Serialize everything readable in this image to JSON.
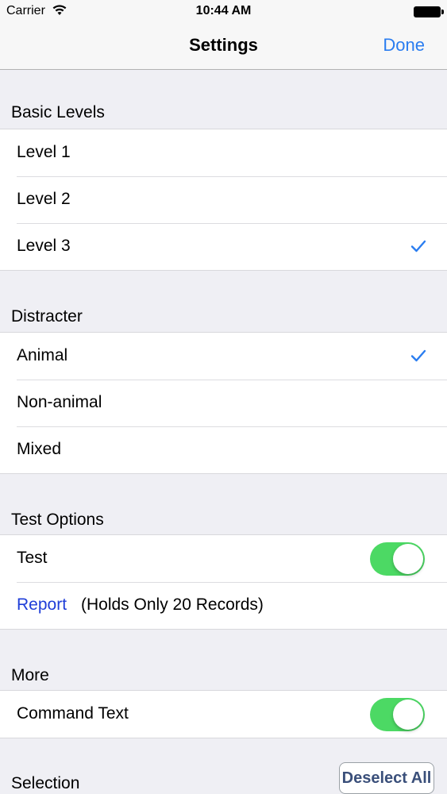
{
  "status_bar": {
    "carrier": "Carrier",
    "time": "10:44 AM"
  },
  "nav": {
    "title": "Settings",
    "done_label": "Done"
  },
  "sections": {
    "basic_levels": {
      "header": "Basic Levels",
      "items": [
        {
          "label": "Level 1",
          "checked": false
        },
        {
          "label": "Level 2",
          "checked": false
        },
        {
          "label": "Level 3",
          "checked": true
        }
      ]
    },
    "distracter": {
      "header": "Distracter",
      "items": [
        {
          "label": "Animal",
          "checked": true
        },
        {
          "label": "Non-animal",
          "checked": false
        },
        {
          "label": "Mixed",
          "checked": false
        }
      ]
    },
    "test_options": {
      "header": "Test Options",
      "test": {
        "label": "Test",
        "on": true
      },
      "report": {
        "link": "Report",
        "note": "(Holds Only 20 Records)"
      }
    },
    "more": {
      "header": "More",
      "command_text": {
        "label": "Command Text",
        "on": true
      }
    },
    "selection": {
      "header": "Selection",
      "deselect_label": "Deselect All"
    }
  },
  "colors": {
    "accent": "#2a7df0",
    "switch_on": "#4cd964",
    "link": "#1f3ed8",
    "background": "#efeff4"
  }
}
